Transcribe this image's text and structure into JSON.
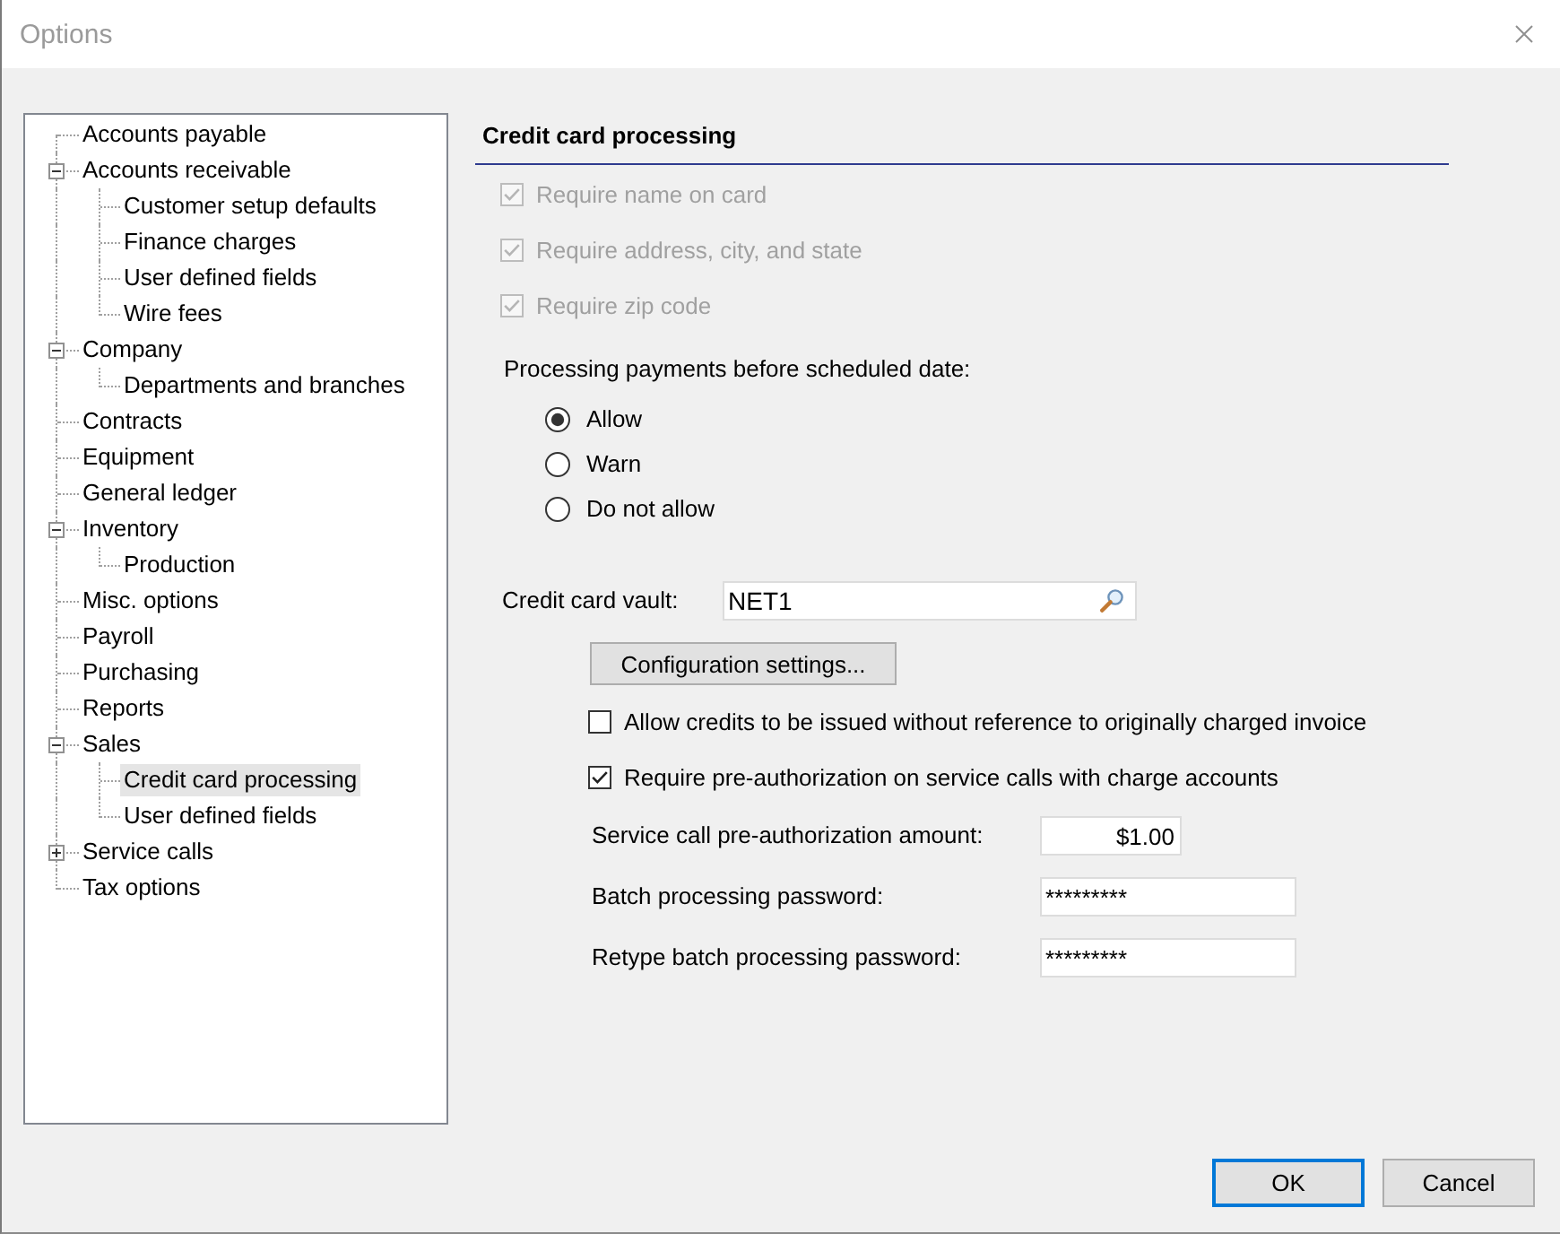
{
  "window": {
    "title": "Options"
  },
  "tree": [
    {
      "label": "Accounts payable",
      "selected": false
    },
    {
      "label": "Accounts receivable",
      "expanded": true,
      "selected": false,
      "children": [
        {
          "label": "Customer setup defaults",
          "selected": false
        },
        {
          "label": "Finance charges",
          "selected": false
        },
        {
          "label": "User defined fields",
          "selected": false
        },
        {
          "label": "Wire fees",
          "selected": false
        }
      ]
    },
    {
      "label": "Company",
      "expanded": true,
      "selected": false,
      "children": [
        {
          "label": "Departments and branches",
          "selected": false
        }
      ]
    },
    {
      "label": "Contracts",
      "selected": false
    },
    {
      "label": "Equipment",
      "selected": false
    },
    {
      "label": "General ledger",
      "selected": false
    },
    {
      "label": "Inventory",
      "expanded": true,
      "selected": false,
      "children": [
        {
          "label": "Production",
          "selected": false
        }
      ]
    },
    {
      "label": "Misc. options",
      "selected": false
    },
    {
      "label": "Payroll",
      "selected": false
    },
    {
      "label": "Purchasing",
      "selected": false
    },
    {
      "label": "Reports",
      "selected": false
    },
    {
      "label": "Sales",
      "expanded": true,
      "selected": false,
      "children": [
        {
          "label": "Credit card processing",
          "selected": true
        },
        {
          "label": "User defined fields",
          "selected": false
        }
      ]
    },
    {
      "label": "Service calls",
      "expanded": false,
      "selected": false
    },
    {
      "label": "Tax options",
      "selected": false
    }
  ],
  "section": {
    "title": "Credit card processing"
  },
  "required_fields": [
    {
      "label": "Require name on card",
      "checked": true,
      "disabled": true
    },
    {
      "label": "Require address, city, and state",
      "checked": true,
      "disabled": true
    },
    {
      "label": "Require zip code",
      "checked": true,
      "disabled": true
    }
  ],
  "payment_timing": {
    "label": "Processing payments before scheduled date:",
    "options": [
      {
        "label": "Allow",
        "selected": true
      },
      {
        "label": "Warn",
        "selected": false
      },
      {
        "label": "Do not allow",
        "selected": false
      }
    ]
  },
  "vault": {
    "kind": "lookup",
    "label": "Credit card vault:",
    "value": "NET1"
  },
  "config_button": {
    "label": "Configuration settings..."
  },
  "credit_options": [
    {
      "label": "Allow credits to be issued without reference to originally charged invoice",
      "checked": false,
      "disabled": false
    },
    {
      "label": "Require pre-authorization on service calls with charge accounts",
      "checked": true,
      "disabled": false
    }
  ],
  "fields": [
    {
      "kind": "amount",
      "label": "Service call pre-authorization amount:",
      "value": "$1.00"
    },
    {
      "kind": "password",
      "label": "Batch processing password:",
      "value": "*********"
    },
    {
      "kind": "password",
      "label": "Retype batch processing password:",
      "value": "*********"
    }
  ],
  "buttons": [
    {
      "label": "OK",
      "default": true
    },
    {
      "label": "Cancel",
      "default": false
    }
  ]
}
